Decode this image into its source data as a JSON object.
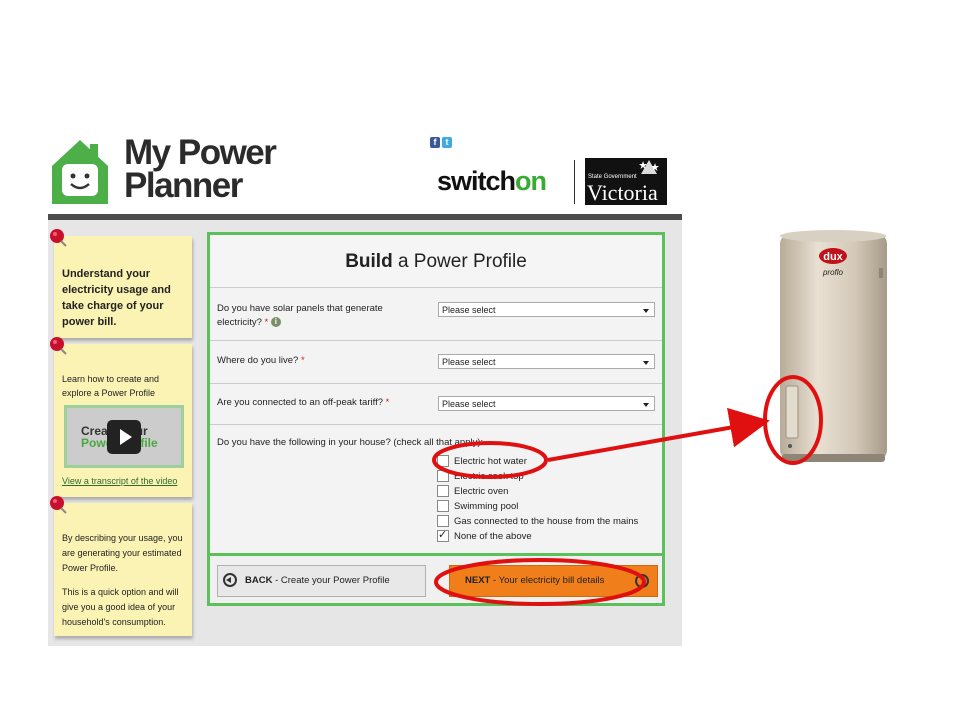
{
  "header": {
    "logo_line1": "My Power",
    "logo_line2": "Planner",
    "social": [
      "f",
      "t"
    ],
    "brand_switch": "switch",
    "brand_on": "on",
    "vic_small": "State Government",
    "vic_big": "Victoria"
  },
  "sidebar": {
    "note1": "Understand your electricity usage and take charge of your power bill.",
    "note2_text": "Learn how to create and explore a Power Profile",
    "video_line1": "Create your",
    "video_line2": "Power Profile",
    "video_link": "View a transcript of the video",
    "note3_p1": "By describing your usage, you are generating your estimated Power Profile.",
    "note3_p2": "This is a quick option and will give you a good idea of your household's consumption."
  },
  "form": {
    "title_bold": "Build",
    "title_rest": " a Power Profile",
    "q_solar": "Do you have solar panels that generate electricity?",
    "q_live": "Where do you live?",
    "q_tariff": "Are you connected to an off-peak tariff?",
    "required_mark": "*",
    "info_mark": "i",
    "select_placeholder": "Please select",
    "q_have": "Do you have the following in your house? (check all that apply):",
    "options": [
      {
        "label": "Electric hot water",
        "checked": false
      },
      {
        "label": "Electric cook top",
        "checked": false
      },
      {
        "label": "Electric oven",
        "checked": false
      },
      {
        "label": "Swimming pool",
        "checked": false
      },
      {
        "label": "Gas connected to the house from the mains",
        "checked": false
      },
      {
        "label": "None of the above",
        "checked": true
      }
    ],
    "back_bold": "BACK",
    "back_rest": " - Create your Power Profile",
    "next_bold": "NEXT",
    "next_rest": " - Your electricity bill details"
  },
  "heater": {
    "brand": "dux",
    "model": "proflo"
  },
  "colors": {
    "green": "#5cc15a",
    "orange": "#f07e1a",
    "note_yellow": "#fbf3b4",
    "annotation_red": "#e01010"
  }
}
